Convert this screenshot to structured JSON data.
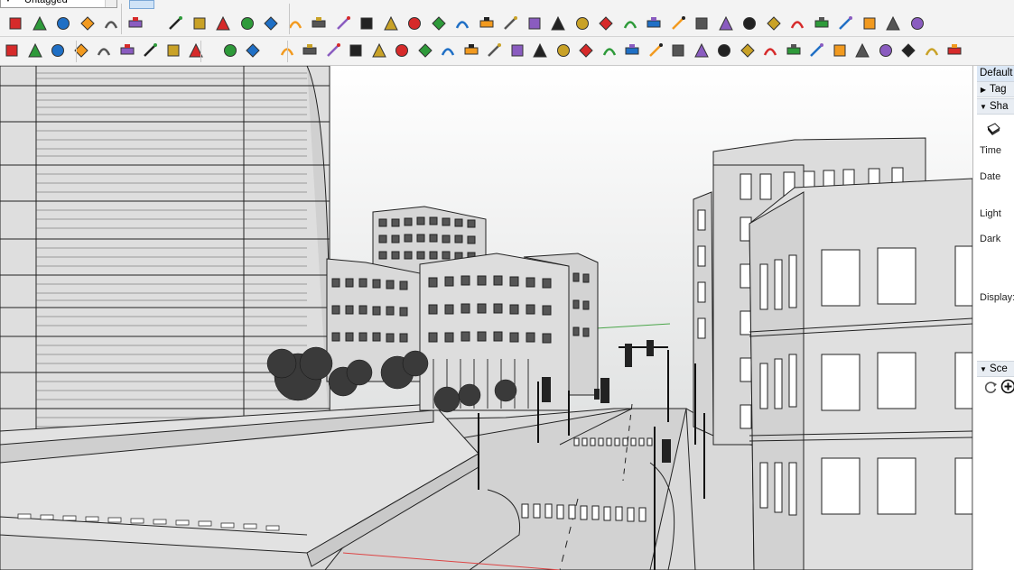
{
  "toolbar": {
    "tag_dropdown_value": "Untagged"
  },
  "tray": {
    "panel_title": "Default",
    "sections": [
      {
        "label": "Tag",
        "expanded": false
      },
      {
        "label": "Sha",
        "expanded": true
      },
      {
        "label": "Sce",
        "expanded": true
      }
    ],
    "shadow_labels": {
      "time": "Time",
      "date": "Date",
      "light": "Light",
      "dark": "Dark",
      "display": "Display:"
    }
  },
  "colors": {
    "sky_top": "#ffffff",
    "sky_bottom": "#d6d8d8",
    "building_fill": "#dcdcdc",
    "window_fill": "#6e6e6e",
    "toolbar_bg": "#f3f3f3",
    "tray_header": "#e8edf3",
    "accent_red": "#d62a2a",
    "accent_green": "#2e9a3a",
    "accent_blue": "#1f6fc5",
    "accent_orange": "#f29a1f"
  },
  "icons_row1": [
    "component-icon",
    "layer-icon",
    "material-icon",
    "paint-icon",
    "ruby-icon",
    "eraser-icon",
    "orbit-icon",
    "rect-icon",
    "table-icon",
    "flag-icon",
    "box-icon",
    "link-icon",
    "curve-icon",
    "plus-red-icon",
    "plus-green-icon",
    "move-icon",
    "cone-icon",
    "warning-icon",
    "rotate-icon",
    "spiral-icon",
    "arrow-icon",
    "star-icon",
    "cube-icon",
    "puzzle-icon",
    "gear-arrows-icon",
    "camera-icon",
    "u-turn-icon",
    "sweep-icon",
    "chart-icon",
    "grid-orange-icon",
    "grid-yellow-icon",
    "grid-yellow-2-icon",
    "scatter-icon",
    "circle-dash-icon",
    "grid-small-icon",
    "cube-dark-icon",
    "cube-light-icon",
    "dual-cube-icon"
  ],
  "icons_row2": [
    "solid-icon",
    "refresh-icon",
    "stack-icon",
    "add-icon",
    "tree-icon",
    "plant-icon",
    "checker-icon",
    "cloud-icon",
    "settings-icon",
    "mail-icon",
    "info-icon",
    "select-face-icon",
    "dots-icon",
    "follow-icon",
    "scissors-icon",
    "extrude-icon",
    "bend-icon",
    "box-3d-icon",
    "twist-icon",
    "curl-icon",
    "corner-icon",
    "fold-icon",
    "slice-icon",
    "rotate-path-icon",
    "offset-icon",
    "bars-icon",
    "column-icon",
    "drape-icon",
    "hand-icon",
    "warp-icon",
    "flip-icon",
    "layers-icon",
    "ruler-icon",
    "arrow-right-icon",
    "arrow-dbl-icon",
    "path-icon",
    "mesh-icon",
    "stairs-icon",
    "slab-icon",
    "roof-icon",
    "fence-icon"
  ]
}
